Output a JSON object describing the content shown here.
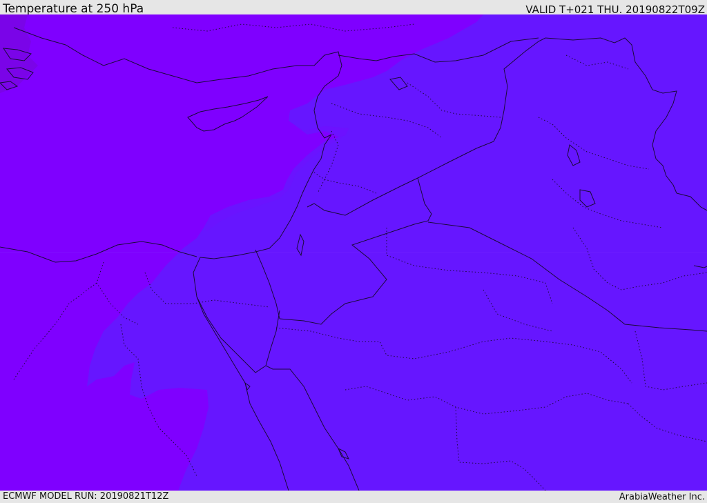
{
  "header": {
    "title": "Temperature at 250 hPa",
    "valid_time": "VALID T+021 THU. 20190822T09Z"
  },
  "footer": {
    "model_run": "ECMWF MODEL RUN: 20190821T12Z",
    "credit": "ArabiaWeather Inc."
  },
  "colors": {
    "zone_cold": "#7f00ff",
    "zone_cooler": "#6a13ff",
    "zone_cool": "#6616ff",
    "zone_purple_dark": "#7a04e8",
    "border_line": "#1a0a3a",
    "frame_bg": "#e6e6e6"
  }
}
